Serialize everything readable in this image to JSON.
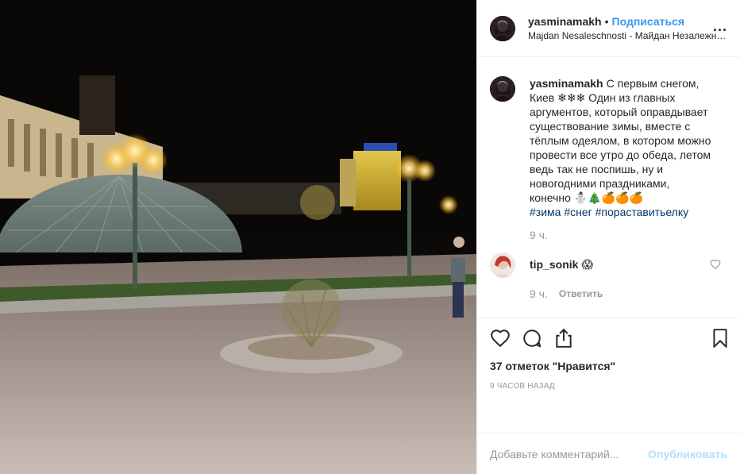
{
  "header": {
    "username": "yasminamakh",
    "separator": "•",
    "follow_label": "Подписаться",
    "location": "Majdan Nesaleschnosti - Майдан Незалежно...",
    "more_label": "..."
  },
  "caption": {
    "username": "yasminamakh",
    "text": "С первым снегом, Киев ❄❄❄ Один из главных аргументов, который оправдывает существование зимы, вместе с тёплым одеялом, в котором можно провести все утро до обеда, летом ведь так не поспишь, ну и новогодними праздниками, конечно ⛄🎄🍊🍊🍊",
    "hashtags": "#зима #снег #пораставитьелку",
    "time": "9 ч."
  },
  "comment": {
    "username": "tip_sonik",
    "text": "😱",
    "time": "9 ч.",
    "reply_label": "Ответить"
  },
  "actions": {
    "likes": "37 отметок \"Нравится\"",
    "posted": "9 часов назад"
  },
  "add_comment": {
    "placeholder": "Добавьте комментарий...",
    "publish_label": "Опубликовать"
  },
  "icons": {
    "like": "heart-icon",
    "comment": "comment-bubble-icon",
    "share": "share-icon",
    "save": "bookmark-icon",
    "comment_like": "heart-icon",
    "more": "ellipsis-icon"
  },
  "colors": {
    "link": "#3897f0",
    "hashtag": "#003569",
    "muted": "#999999",
    "publish_disabled": "#b2dffc",
    "border": "#efefef"
  }
}
